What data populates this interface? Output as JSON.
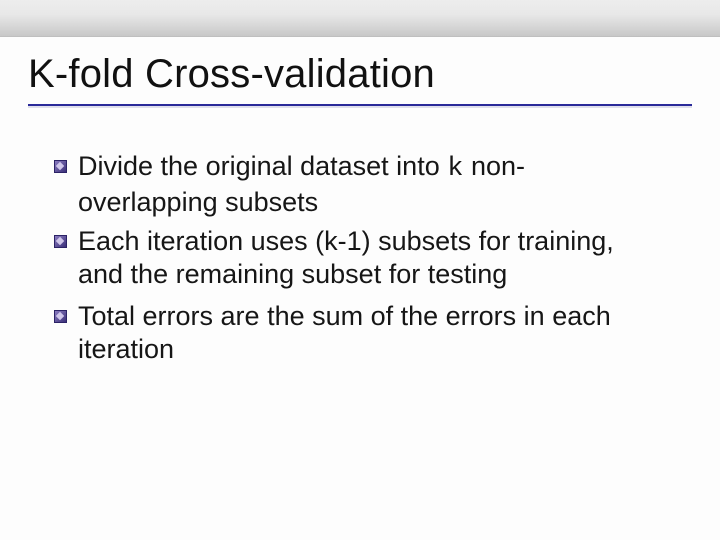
{
  "slide": {
    "title": "K-fold Cross-validation",
    "bullets": [
      {
        "pre": "Divide the original dataset into ",
        "mono": "k",
        "post": " non-overlapping subsets"
      },
      {
        "pre": "Each iteration uses (k-1) subsets for training, and the remaining subset for testing",
        "mono": "",
        "post": ""
      },
      {
        "pre": "Total errors are the sum of the errors in each iteration",
        "mono": "",
        "post": ""
      }
    ]
  }
}
